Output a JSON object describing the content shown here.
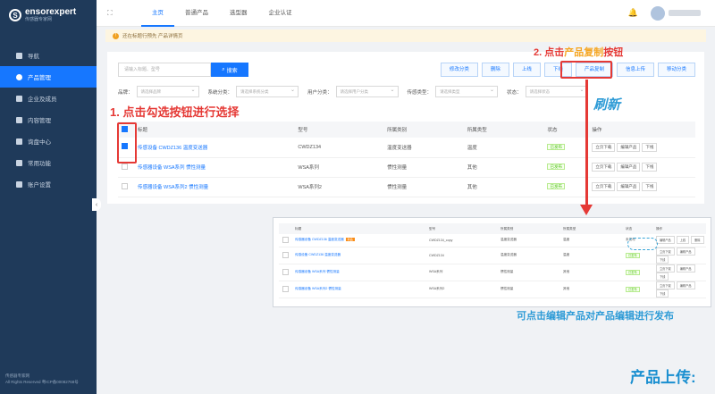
{
  "sidebar": {
    "logo_text": "ensorexpert",
    "logo_sub": "传感器专家网",
    "items": [
      {
        "label": "导航",
        "icon": "home-icon"
      },
      {
        "label": "产品管理",
        "icon": "product-icon",
        "active": true
      },
      {
        "label": "企业及成员",
        "icon": "company-icon"
      },
      {
        "label": "内容管理",
        "icon": "content-icon"
      },
      {
        "label": "询盘中心",
        "icon": "inquiry-icon"
      },
      {
        "label": "常用功能",
        "icon": "tools-icon"
      },
      {
        "label": "账户设置",
        "icon": "settings-icon"
      }
    ],
    "footer_line1": "传感器专家网",
    "footer_line2": "All Rights Reserved 粤ICP备00082768号"
  },
  "topbar": {
    "tabs": [
      "主页",
      "普通产品",
      "选型器",
      "企业认证"
    ]
  },
  "notice": {
    "text": "还在标题行预先 产品详情页"
  },
  "search": {
    "placeholder": "请输入标题、型号",
    "button": "搜索"
  },
  "actions": [
    "修改分类",
    "删除",
    "上线",
    "下线",
    "产品复制",
    "信息上传",
    "移动分类"
  ],
  "filters": [
    {
      "label": "品牌：",
      "placeholder": "请选择品牌"
    },
    {
      "label": "系统分类：",
      "placeholder": "请选择系统分类"
    },
    {
      "label": "用户分类：",
      "placeholder": "请选择用户分类"
    },
    {
      "label": "传感类型：",
      "placeholder": "请选择类型"
    },
    {
      "label": "状态：",
      "placeholder": "请选择状态"
    }
  ],
  "table": {
    "headers": [
      "标题",
      "型号",
      "所属类别",
      "所属类型",
      "状态",
      "操作"
    ],
    "rows": [
      {
        "title": "传感设备 CWDZ136 温度变送器",
        "model": "CWDZ134",
        "category": "温度变送器",
        "type": "温度",
        "status": "已发布",
        "checked": true
      },
      {
        "title": "传感器设备 WSA系列 惯性测量",
        "model": "WSA系列",
        "category": "惯性测量",
        "type": "其他",
        "status": "已发布",
        "checked": false
      },
      {
        "title": "传感器设备 WSA系列2 惯性测量",
        "model": "WSA系列2",
        "category": "惯性测量",
        "type": "其他",
        "status": "已发布",
        "checked": false
      }
    ],
    "ops": [
      "立页下载",
      "编辑产品",
      "下线"
    ]
  },
  "preview": {
    "headers": [
      "标题",
      "型号",
      "所属类别",
      "所属类型",
      "状态",
      "操作"
    ],
    "new_tag": "新品",
    "rows": [
      {
        "title": "传感器设备 CWDZ136 温度变送器",
        "model": "CWDZ134_copy",
        "category": "温度变送器",
        "type": "温度",
        "status": "未发布",
        "ops": [
          "编辑产品",
          "上线",
          "删除"
        ]
      },
      {
        "title": "传感设备 CWDZ136 温度变送器",
        "model": "CWDZ134",
        "category": "温度变送器",
        "type": "温度",
        "status": "已发布",
        "ops": [
          "立页下载",
          "编辑产品",
          "下线"
        ]
      },
      {
        "title": "传感器设备 WSA系列 惯性测量",
        "model": "WSA系列",
        "category": "惯性测量",
        "type": "其他",
        "status": "已发布",
        "ops": [
          "立页下载",
          "编辑产品",
          "下线"
        ]
      },
      {
        "title": "传感器设备 WSA系列2 惯性测量",
        "model": "WSA系列2",
        "category": "惯性测量",
        "type": "其他",
        "status": "已发布",
        "ops": [
          "立页下载",
          "编辑产品",
          "下线"
        ]
      }
    ]
  },
  "annotations": {
    "step1": "1. 点击勾选按钮进行选择",
    "step2_prefix": "2. 点击",
    "step2_highlight": "产品复制",
    "step2_suffix": "按钮",
    "refresh": "刷新",
    "edit_hint": "可点击编辑产品对产品编辑进行发布",
    "upload_title": "产品上传:"
  },
  "colors": {
    "sidebar": "#1f3a5a",
    "primary": "#1677ff",
    "annotation_red": "#e53935",
    "annotation_blue": "#2e9bd6",
    "highlight_orange": "#f5a623"
  }
}
